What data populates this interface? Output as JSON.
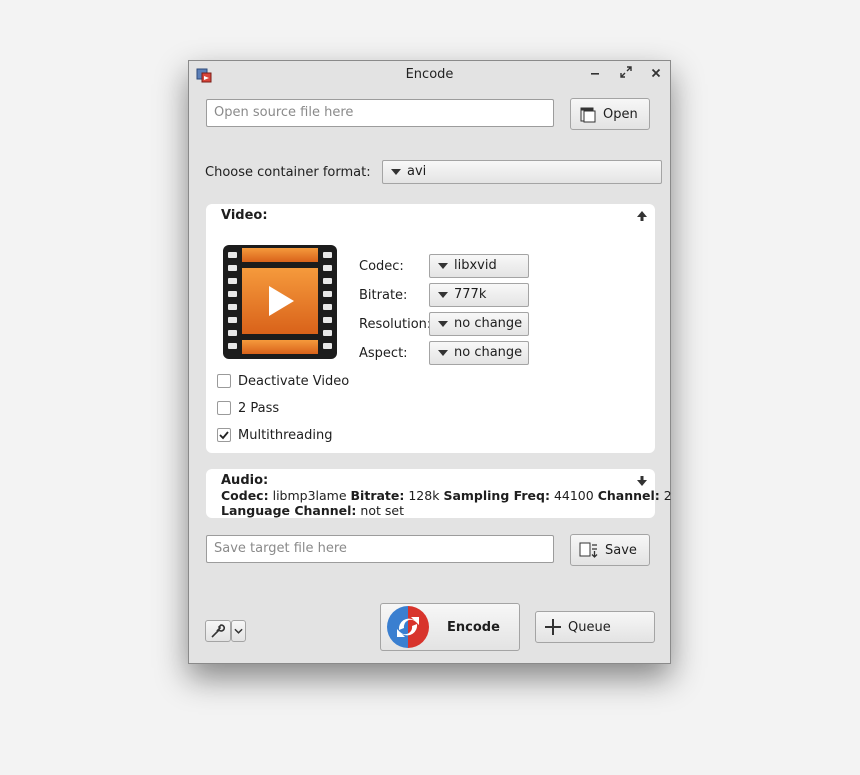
{
  "window": {
    "title": "Encode"
  },
  "source": {
    "placeholder": "Open source file here",
    "open_label": "Open"
  },
  "container": {
    "label": "Choose container format:",
    "value": "avi"
  },
  "video": {
    "title": "Video:",
    "fields": [
      {
        "label": "Codec:",
        "value": "libxvid"
      },
      {
        "label": "Bitrate:",
        "value": "777k"
      },
      {
        "label": "Resolution:",
        "value": "no change"
      },
      {
        "label": "Aspect:",
        "value": "no change"
      }
    ],
    "options": [
      {
        "label": "Deactivate Video",
        "checked": false
      },
      {
        "label": "2 Pass",
        "checked": false
      },
      {
        "label": "Multithreading",
        "checked": true
      }
    ]
  },
  "audio": {
    "title": "Audio:",
    "codec_key": "Codec:",
    "codec_value": "libmp3lame",
    "bitrate_key": "Bitrate:",
    "bitrate_value": "128k",
    "sampling_key": "Sampling Freq:",
    "sampling_value": "44100",
    "channel_key": "Channel:",
    "channel_value": "2",
    "language_key": "Language Channel:",
    "language_value": "not set"
  },
  "target": {
    "placeholder": "Save target file here",
    "save_label": "Save"
  },
  "actions": {
    "encode_label": "Encode",
    "queue_label": "Queue"
  },
  "colors": {
    "accent_orange": "#e8741c",
    "encode_red": "#d8342c",
    "encode_blue": "#3a7fd0"
  }
}
